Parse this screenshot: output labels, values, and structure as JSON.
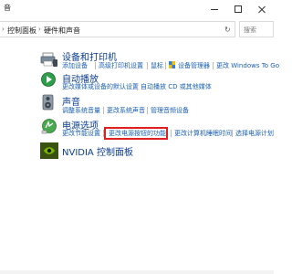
{
  "window": {
    "title": "音"
  },
  "address": {
    "breadcrumbs": [
      "控制面板",
      "硬件和声音"
    ],
    "search_placeholder": "搜索"
  },
  "categories": [
    {
      "title": "设备和打印机",
      "links": [
        "添加设备",
        "高级打印机设置",
        "鼠标",
        "设备管理器",
        "更改 Windows To Go"
      ]
    },
    {
      "title": "自动播放",
      "links": [
        "更改媒体或设备的默认设置",
        "自动播放 CD 或其他媒体"
      ]
    },
    {
      "title": "声音",
      "links": [
        "调整系统音量",
        "更改系统声音",
        "管理音频设备"
      ]
    },
    {
      "title": "电源选项",
      "links": [
        "更改节能设置",
        "更改电源按钮的功能",
        "更改计算机睡眠时间",
        "选择电源计划"
      ]
    },
    {
      "title": "NVIDIA 控制面板",
      "links": []
    }
  ],
  "colors": {
    "link": "#1a5fb4",
    "heading": "#0a3d91",
    "highlight": "#e02020"
  }
}
